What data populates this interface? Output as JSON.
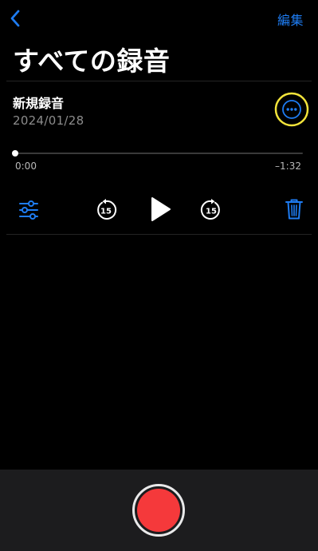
{
  "header": {
    "back_icon": "chevron-left-icon",
    "edit_label": "編集",
    "title": "すべての録音"
  },
  "recording": {
    "title": "新規録音",
    "date": "2024/01/28",
    "more_icon": "ellipsis-circle-icon",
    "highlight_color": "#f2e33a",
    "progress": 0.0,
    "elapsed": "0:00",
    "remaining": "–1:32"
  },
  "controls": {
    "options_icon": "sliders-icon",
    "rewind_icon": "skip-back-15-icon",
    "rewind_label": "15",
    "play_icon": "play-icon",
    "forward_icon": "skip-forward-15-icon",
    "forward_label": "15",
    "delete_icon": "trash-icon"
  },
  "colors": {
    "accent": "#1e7cf2",
    "record": "#f5393b",
    "background": "#000000",
    "panel": "#1c1c1e"
  },
  "bottom": {
    "record_icon": "record-icon"
  }
}
